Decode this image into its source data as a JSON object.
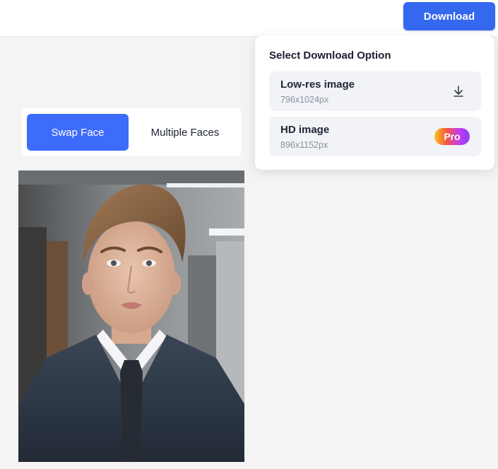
{
  "header": {
    "download_label": "Download"
  },
  "tabs": [
    {
      "label": "Swap Face",
      "active": true
    },
    {
      "label": "Multiple Faces",
      "active": false
    }
  ],
  "dropdown": {
    "title": "Select Download Option",
    "options": [
      {
        "name": "Low-res image",
        "size": "796x1024px",
        "icon": "download-icon"
      },
      {
        "name": "HD image",
        "size": "896x1152px",
        "badge": "Pro"
      }
    ]
  },
  "colors": {
    "accent": "#3468ef",
    "tab_active": "#3d6bfa",
    "option_bg": "#f1f3f7",
    "page_bg": "#f4f4f4"
  }
}
